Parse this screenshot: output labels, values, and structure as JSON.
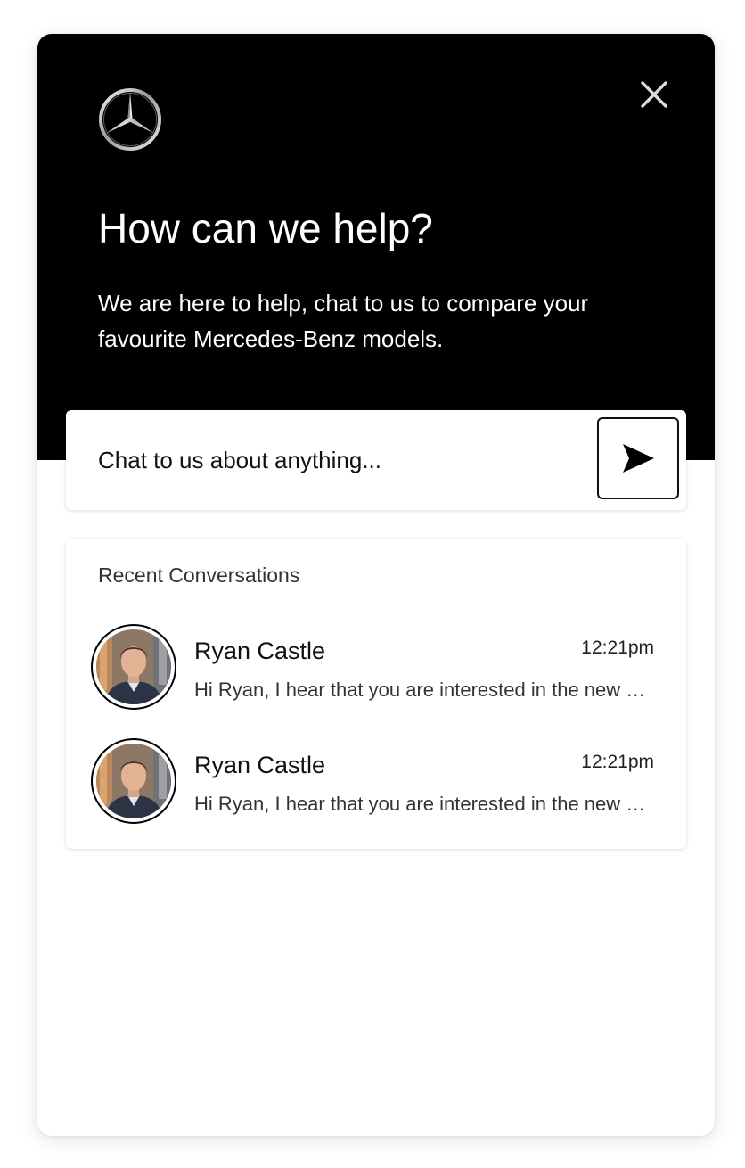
{
  "colors": {
    "hero_background": "#000000",
    "hero_text": "#ffffff",
    "body_text": "#111111",
    "card_background": "#ffffff"
  },
  "header": {
    "logo_icon": "mercedes-benz-star-icon",
    "close_icon": "close-icon",
    "title": "How can we help?",
    "subtitle": "We are here to help, chat to us to compare your favourite Mercedes-Benz models."
  },
  "chat": {
    "placeholder": "Chat to us about anything...",
    "send_icon": "send-arrow-icon"
  },
  "recent": {
    "heading": "Recent Conversations",
    "conversations": [
      {
        "name": "Ryan Castle",
        "time": "12:21pm",
        "preview": "Hi Ryan, I hear that you are interested in the new Mercedes-Benz models."
      },
      {
        "name": "Ryan Castle",
        "time": "12:21pm",
        "preview": "Hi Ryan, I hear that you are interested in the new Mercedes-Benz models."
      }
    ]
  }
}
